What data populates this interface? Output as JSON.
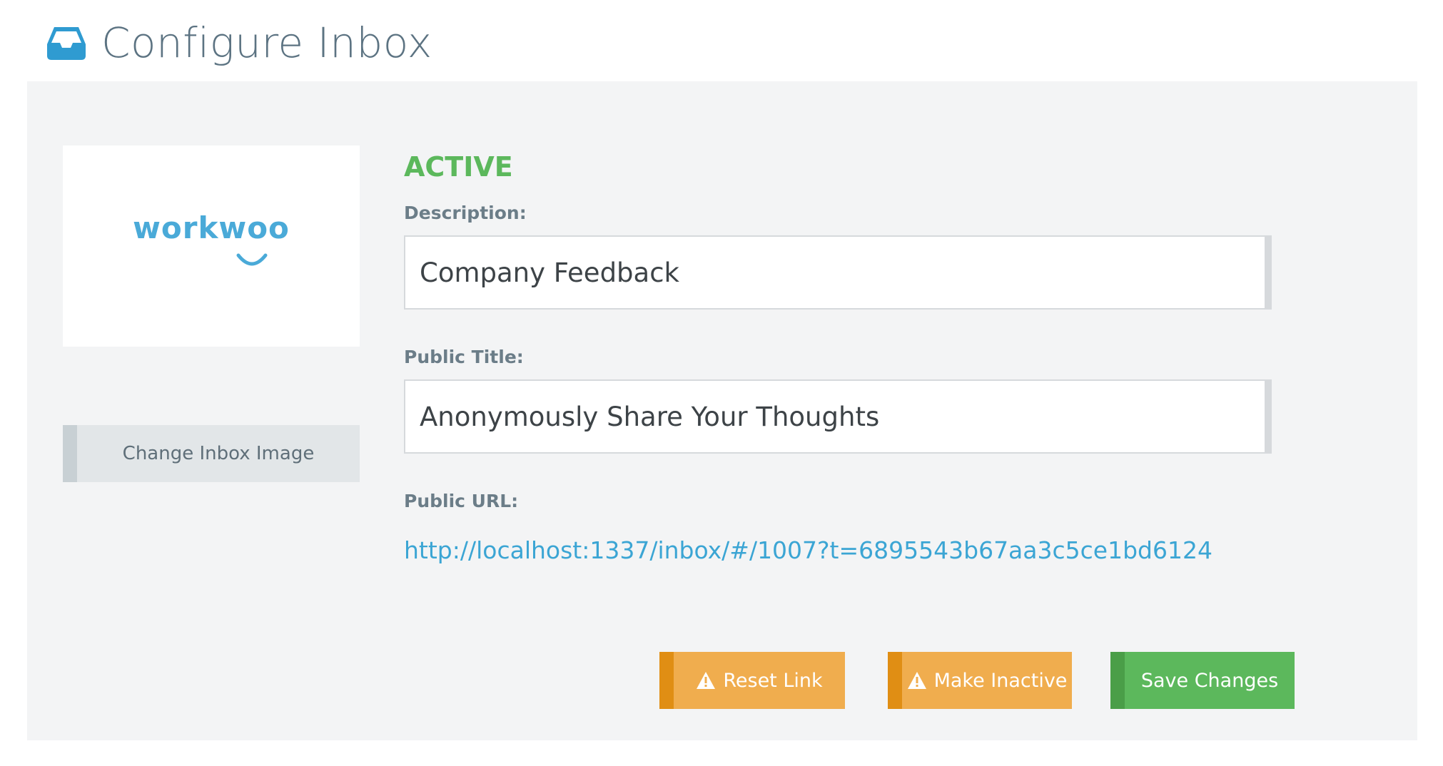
{
  "header": {
    "title": "Configure Inbox",
    "icon": "inbox-icon"
  },
  "sidebar": {
    "logo_text": "workwoo",
    "change_image_label": "Change Inbox Image"
  },
  "form": {
    "status": "ACTIVE",
    "description_label": "Description:",
    "description_value": "Company Feedback",
    "public_title_label": "Public Title:",
    "public_title_value": "Anonymously Share Your Thoughts",
    "public_url_label": "Public URL:",
    "public_url": "http://localhost:1337/inbox/#/1007?t=6895543b67aa3c5ce1bd6124"
  },
  "actions": {
    "reset_link_label": "Reset Link",
    "make_inactive_label": "Make Inactive",
    "save_changes_label": "Save Changes"
  },
  "colors": {
    "brand_blue": "#2f9bd1",
    "active_green": "#5cb85c",
    "warning_orange": "#f0ad4e",
    "link_blue": "#3ba5d4",
    "panel_bg": "#f3f4f5"
  }
}
